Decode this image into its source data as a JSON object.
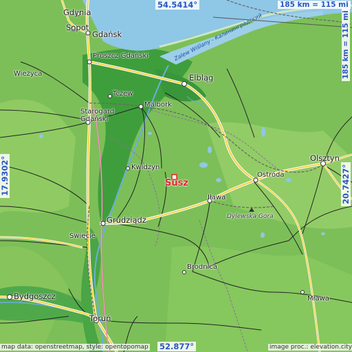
{
  "map": {
    "target": "Susz",
    "coords": {
      "top": "54.5414°",
      "bottom": "52.877°",
      "left": "17.9302°",
      "right": "20.7427°"
    },
    "scale": {
      "horizontal": "185 km = 115 mi",
      "vertical": "185 km = 115 mi"
    },
    "credits": {
      "left": "map data: openstreetmap, style: opentopomap",
      "right": "image proc.: elevation.city"
    },
    "water_label": "Zalew Wiślany - Калининградский",
    "cities": [
      {
        "id": "gdynia",
        "name": "Gdynia"
      },
      {
        "id": "sopot",
        "name": "Sopot"
      },
      {
        "id": "gdansk",
        "name": "Gdańsk"
      },
      {
        "id": "pruszcz",
        "name": "Pruszcz Gdański"
      },
      {
        "id": "elblag",
        "name": "Elbląg"
      },
      {
        "id": "wiezyca",
        "name": "Wieżyca"
      },
      {
        "id": "tczew",
        "name": "Tczew"
      },
      {
        "id": "malbork",
        "name": "Malbork"
      },
      {
        "id": "starogard",
        "name": "Starogard\nGdański"
      },
      {
        "id": "kwidzyn",
        "name": "Kwidzyn"
      },
      {
        "id": "ilawa",
        "name": "Iława"
      },
      {
        "id": "ostroda",
        "name": "Ostróda"
      },
      {
        "id": "olsztyn",
        "name": "Olsztyn"
      },
      {
        "id": "grudziadz",
        "name": "Grudziądz"
      },
      {
        "id": "swiecie",
        "name": "Świecie"
      },
      {
        "id": "brodnica",
        "name": "Brodnica"
      },
      {
        "id": "bydgoszcz",
        "name": "Bydgoszcz"
      },
      {
        "id": "torun",
        "name": "Toruń"
      },
      {
        "id": "mlawa",
        "name": "Mława"
      }
    ],
    "hill": "Dylewska Góra"
  }
}
